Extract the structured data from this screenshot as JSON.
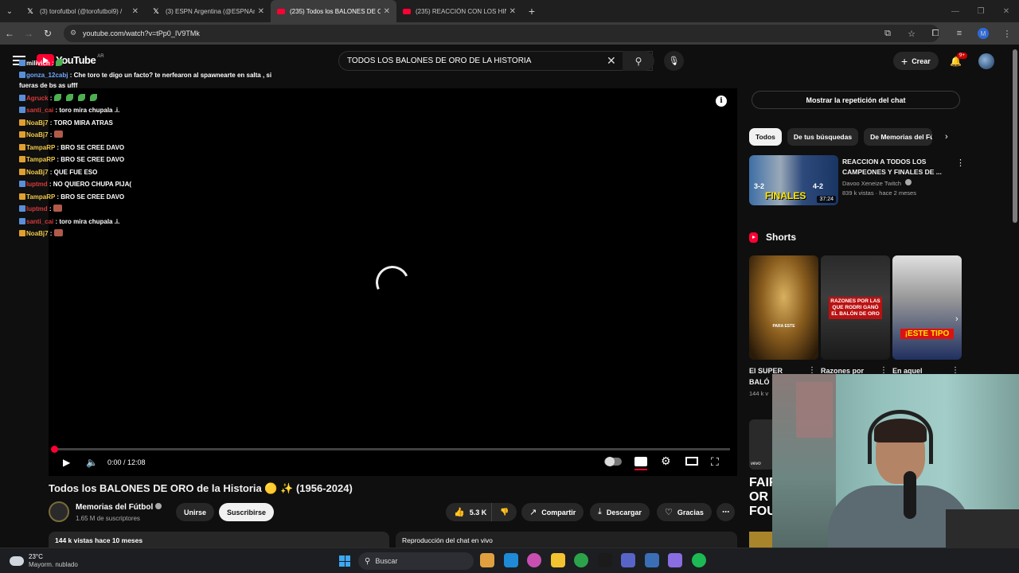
{
  "browser": {
    "tabs": [
      {
        "title": "(3) torofutbol (@torofutbol9) /",
        "favicon": "x-icon",
        "active": false
      },
      {
        "title": "(3) ESPN Argentina (@ESPNArg",
        "favicon": "x-icon",
        "active": false
      },
      {
        "title": "(235) Todos los BALONES DE OR",
        "favicon": "youtube-icon",
        "active": true
      },
      {
        "title": "(235) REACCIÓN CON LOS HIN",
        "favicon": "youtube-icon",
        "active": false
      }
    ],
    "url": "youtube.com/watch?v=tPp0_IV9TMk",
    "profile_initial": "M"
  },
  "youtube": {
    "logo_text": "YouTube",
    "country_code": "AR",
    "search_query": "TODOS LOS BALONES DE ORO DE LA HISTORIA",
    "create_label": "Crear",
    "notification_count": "9+"
  },
  "player": {
    "time": "0:00 / 12:08",
    "progress": 0.0
  },
  "chat_overlay": [
    {
      "user": "milivich",
      "msg": "",
      "user_color": "#ffffff",
      "emotes": [
        "green"
      ]
    },
    {
      "user": "gonza_12cabj",
      "msg": "Che toro te digo un facto? te nerfearon al spawnearte en salta , si fueras de bs as ufff",
      "user_color": "#6fa8ff",
      "emotes": [],
      "wrap": true
    },
    {
      "user": "Agruck",
      "msg": "",
      "user_color": "#d63a3a",
      "emotes": [
        "green",
        "green",
        "green",
        "green"
      ]
    },
    {
      "user": "santi_cai",
      "msg": "toro mira chupala .i.",
      "user_color": "#d63a3a",
      "emotes": []
    },
    {
      "user": "NoaBj7",
      "msg": "TORO MIRA ATRAS",
      "user_color": "#f0c94a",
      "emotes": []
    },
    {
      "user": "NoaBj7",
      "msg": "",
      "user_color": "#f0c94a",
      "emotes": [
        "brown"
      ]
    },
    {
      "user": "TampaRP",
      "msg": "BRO SE CREE DAVO",
      "user_color": "#f0c94a",
      "emotes": []
    },
    {
      "user": "TampaRP",
      "msg": "BRO SE CREE DAVO",
      "user_color": "#f0c94a",
      "emotes": []
    },
    {
      "user": "NoaBj7",
      "msg": "QUE FUE ESO",
      "user_color": "#f0c94a",
      "emotes": []
    },
    {
      "user": "luptmd",
      "msg": "NO QUIERO CHUPA PIJA(",
      "user_color": "#d63a3a",
      "emotes": []
    },
    {
      "user": "TampaRP",
      "msg": "BRO SE CREE DAVO",
      "user_color": "#f0c94a",
      "emotes": []
    },
    {
      "user": "luptmd",
      "msg": "",
      "user_color": "#d63a3a",
      "emotes": [
        "brown"
      ]
    },
    {
      "user": "santi_cai",
      "msg": "toro mira chupala .i.",
      "user_color": "#d63a3a",
      "emotes": []
    },
    {
      "user": "NoaBj7",
      "msg": "",
      "user_color": "#f0c94a",
      "emotes": [
        "brown"
      ]
    }
  ],
  "video": {
    "title": "Todos los BALONES DE ORO de la Historia 🟡 ✨ (1956-2024)",
    "channel": "Memorias del Fútbol",
    "subscribers": "1.65 M de suscriptores",
    "join_label": "Unirse",
    "subscribe_label": "Suscribirse",
    "likes": "5.3 K",
    "share_label": "Compartir",
    "download_label": "Descargar",
    "thanks_label": "Gracias",
    "description_meta": "144 k vistas  hace 10 meses",
    "chat_replay_label": "Reproducción del chat en vivo"
  },
  "sidebar": {
    "replay_button": "Mostrar la repetición del chat",
    "chips": [
      "Todos",
      "De tus búsquedas",
      "De Memorias del Fú"
    ],
    "recommended": {
      "title": "REACCION A TODOS LOS CAMPEONES Y FINALES DE ...",
      "channel": "Davoo Xeneize Twitch",
      "meta": "839 k vistas · hace 2 meses",
      "duration": "37:24",
      "thumb_text": "FINALES",
      "score_left": "3-2",
      "score_right": "4-2"
    },
    "shorts_heading": "Shorts",
    "shorts": [
      {
        "label": "El SUPER BALÓ",
        "thumb_text": "PARA ESTE"
      },
      {
        "label": "Razones por",
        "thumb_text": "RAZONES POR LAS QUE RODRI GANÓ EL BALÓN DE ORO"
      },
      {
        "label": "En aquel",
        "thumb_text": "¡ESTE TIPO"
      }
    ],
    "shorts_views": "144 k v",
    "next_video_text": "FAIR OR FOUL",
    "vevo_label": "vevo"
  },
  "taskbar": {
    "temperature": "23°C",
    "weather_desc": "Mayorm. nublado",
    "search_label": "Buscar",
    "icon_colors": [
      "#e0a040",
      "#1f8ad6",
      "#c84fb0",
      "#f2c230",
      "#2ca34a",
      "#1b1b1b",
      "#5964c8",
      "#3a6fb5",
      "#8a6de0",
      "#1db954"
    ]
  }
}
